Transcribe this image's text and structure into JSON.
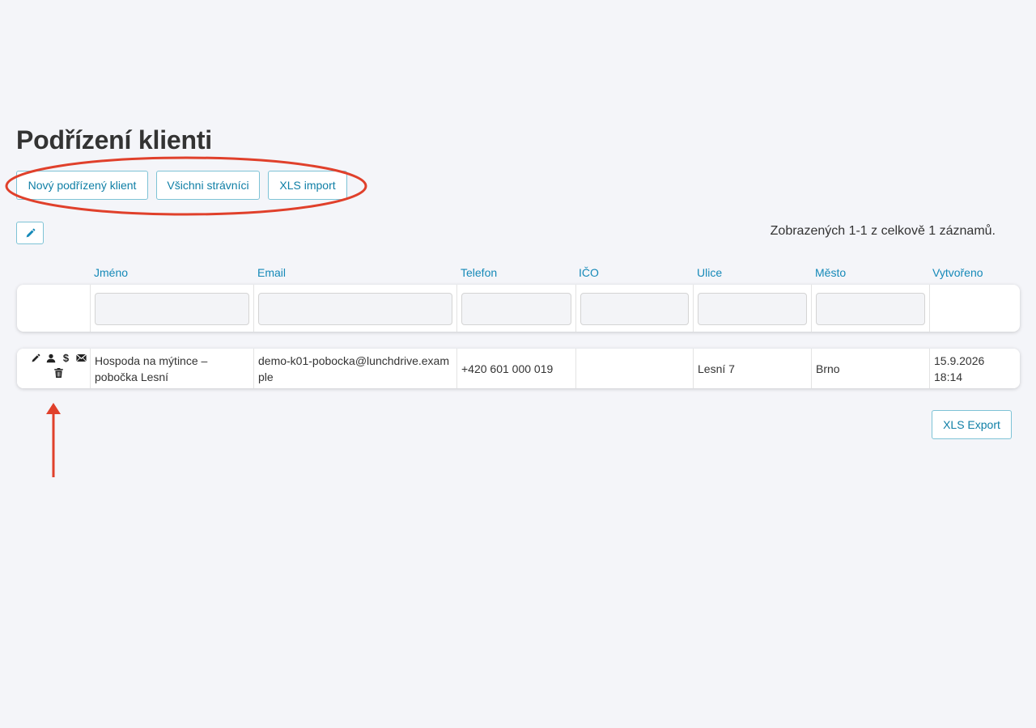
{
  "page": {
    "title": "Podřízení klienti"
  },
  "toolbar": {
    "new_label": "Nový podřízený klient",
    "all_label": "Všichni strávníci",
    "import_label": "XLS import"
  },
  "summary": "Zobrazených 1-1 z celkově 1 záznamů.",
  "table": {
    "columns": [
      "Jméno",
      "Email",
      "Telefon",
      "IČO",
      "Ulice",
      "Město",
      "Vytvořeno"
    ],
    "rows": [
      {
        "name": "Hospoda na mýtince – pobočka Lesní",
        "email": "demo-k01-pobocka@lunchdrive.example",
        "phone": "+420 601 000 019",
        "ico": "",
        "street": "Lesní 7",
        "city": "Brno",
        "created": "15.9.2026 18:14"
      }
    ]
  },
  "footer": {
    "export_label": "XLS Export"
  },
  "icons": [
    "pencil-icon",
    "user-icon",
    "dollar-icon",
    "envelope-icon",
    "trash-icon"
  ],
  "colors": {
    "accent": "#1589b8",
    "button_border": "#7ec3d6",
    "annotation": "#e0402b",
    "background": "#f4f5f9"
  }
}
